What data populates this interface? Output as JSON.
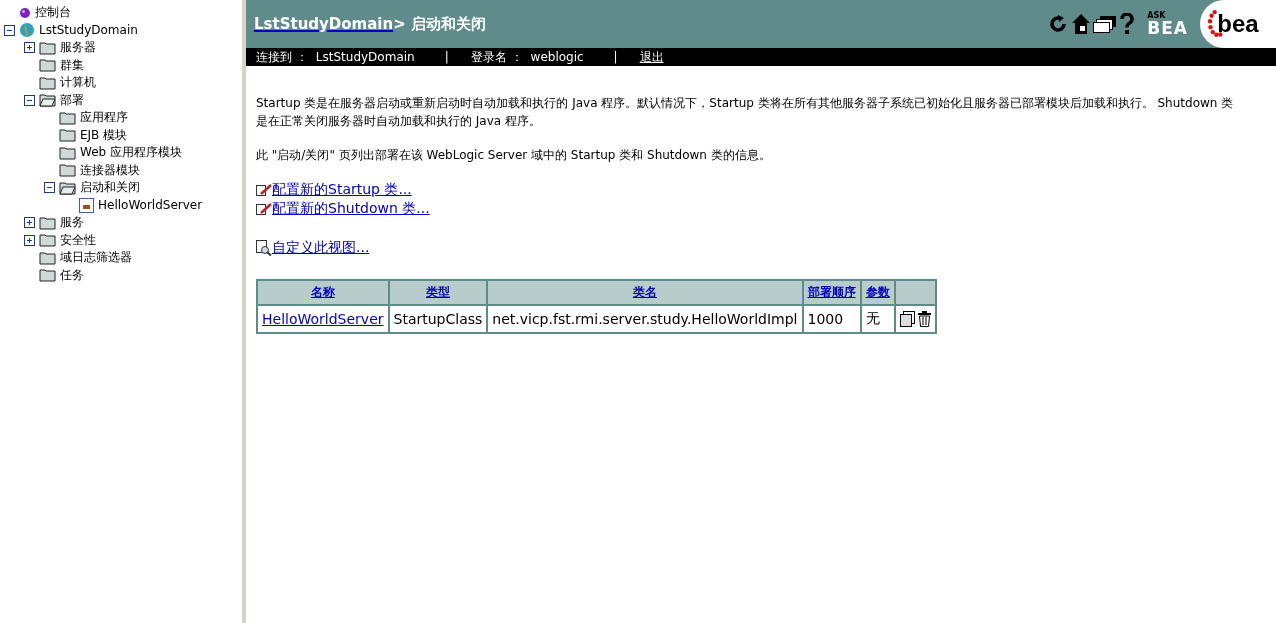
{
  "tree": [
    {
      "label": "控制台",
      "kind": "console"
    },
    {
      "label": "LstStudyDomain",
      "kind": "domain",
      "expanded": true,
      "children": [
        {
          "label": "服务器",
          "kind": "folder",
          "expanded": false
        },
        {
          "label": "群集",
          "kind": "folder"
        },
        {
          "label": "计算机",
          "kind": "folder"
        },
        {
          "label": "部署",
          "kind": "folder",
          "expanded": true,
          "children": [
            {
              "label": "应用程序",
              "kind": "folder"
            },
            {
              "label": "EJB 模块",
              "kind": "folder"
            },
            {
              "label": "Web 应用程序模块",
              "kind": "folder"
            },
            {
              "label": "连接器模块",
              "kind": "folder"
            },
            {
              "label": "启动和关闭",
              "kind": "folder",
              "expanded": true,
              "children": [
                {
                  "label": "HelloWorldServer",
                  "kind": "class"
                }
              ]
            }
          ]
        },
        {
          "label": "服务",
          "kind": "folder",
          "expanded": false
        },
        {
          "label": "安全性",
          "kind": "folder",
          "expanded": false
        },
        {
          "label": "域日志筛选器",
          "kind": "folder"
        },
        {
          "label": "任务",
          "kind": "folder"
        }
      ]
    }
  ],
  "header": {
    "domain_link": "LstStudyDomain",
    "title": "> 启动和关闭",
    "ask_small": "ASK",
    "ask_big": "BEA",
    "logo": "bea"
  },
  "status_bar": {
    "connected_label": "连接到 ：",
    "connected_value": "LstStudyDomain",
    "separator_1": "|",
    "login_label": "登录名 ：",
    "login_value": "weblogic",
    "separator_2": "|",
    "logout": "退出"
  },
  "intro": [
    "Startup 类是在服务器启动或重新启动时自动加载和执行的 Java 程序。默认情况下，Startup 类将在所有其他服务器子系统已初始化且服务器已部署模块后加载和执行。 Shutdown 类是在正常关闭服务器时自动加载和执行的 Java 程序。",
    "此 \"启动/关闭\" 页列出部署在该 WebLogic Server 域中的 Startup 类和 Shutdown 类的信息。"
  ],
  "actions": [
    {
      "label": "配置新的Startup 类...",
      "kind": "edit"
    },
    {
      "label": "配置新的Shutdown 类...",
      "kind": "edit"
    }
  ],
  "customize": {
    "label": "自定义此视图..."
  },
  "table": {
    "columns": [
      "名称",
      "类型",
      "类名",
      "部署顺序",
      "参数"
    ],
    "rows": [
      {
        "cells": [
          "HelloWorldServer",
          "StartupClass",
          "net.vicp.fst.rmi.server.study.HelloWorldImpl",
          "1000",
          "无"
        ]
      }
    ]
  }
}
